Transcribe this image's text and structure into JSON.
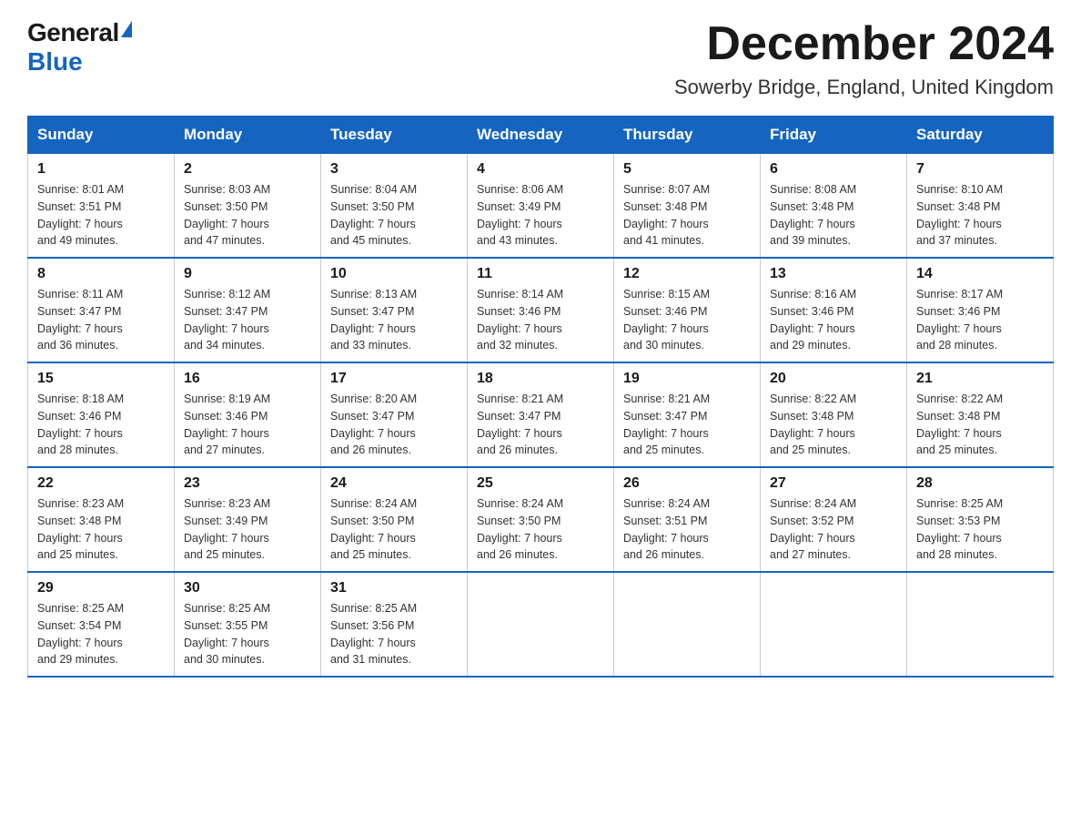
{
  "header": {
    "logo_general": "General",
    "logo_blue": "Blue",
    "title": "December 2024",
    "subtitle": "Sowerby Bridge, England, United Kingdom"
  },
  "weekdays": [
    "Sunday",
    "Monday",
    "Tuesday",
    "Wednesday",
    "Thursday",
    "Friday",
    "Saturday"
  ],
  "weeks": [
    [
      {
        "day": "1",
        "sunrise": "8:01 AM",
        "sunset": "3:51 PM",
        "daylight": "7 hours and 49 minutes."
      },
      {
        "day": "2",
        "sunrise": "8:03 AM",
        "sunset": "3:50 PM",
        "daylight": "7 hours and 47 minutes."
      },
      {
        "day": "3",
        "sunrise": "8:04 AM",
        "sunset": "3:50 PM",
        "daylight": "7 hours and 45 minutes."
      },
      {
        "day": "4",
        "sunrise": "8:06 AM",
        "sunset": "3:49 PM",
        "daylight": "7 hours and 43 minutes."
      },
      {
        "day": "5",
        "sunrise": "8:07 AM",
        "sunset": "3:48 PM",
        "daylight": "7 hours and 41 minutes."
      },
      {
        "day": "6",
        "sunrise": "8:08 AM",
        "sunset": "3:48 PM",
        "daylight": "7 hours and 39 minutes."
      },
      {
        "day": "7",
        "sunrise": "8:10 AM",
        "sunset": "3:48 PM",
        "daylight": "7 hours and 37 minutes."
      }
    ],
    [
      {
        "day": "8",
        "sunrise": "8:11 AM",
        "sunset": "3:47 PM",
        "daylight": "7 hours and 36 minutes."
      },
      {
        "day": "9",
        "sunrise": "8:12 AM",
        "sunset": "3:47 PM",
        "daylight": "7 hours and 34 minutes."
      },
      {
        "day": "10",
        "sunrise": "8:13 AM",
        "sunset": "3:47 PM",
        "daylight": "7 hours and 33 minutes."
      },
      {
        "day": "11",
        "sunrise": "8:14 AM",
        "sunset": "3:46 PM",
        "daylight": "7 hours and 32 minutes."
      },
      {
        "day": "12",
        "sunrise": "8:15 AM",
        "sunset": "3:46 PM",
        "daylight": "7 hours and 30 minutes."
      },
      {
        "day": "13",
        "sunrise": "8:16 AM",
        "sunset": "3:46 PM",
        "daylight": "7 hours and 29 minutes."
      },
      {
        "day": "14",
        "sunrise": "8:17 AM",
        "sunset": "3:46 PM",
        "daylight": "7 hours and 28 minutes."
      }
    ],
    [
      {
        "day": "15",
        "sunrise": "8:18 AM",
        "sunset": "3:46 PM",
        "daylight": "7 hours and 28 minutes."
      },
      {
        "day": "16",
        "sunrise": "8:19 AM",
        "sunset": "3:46 PM",
        "daylight": "7 hours and 27 minutes."
      },
      {
        "day": "17",
        "sunrise": "8:20 AM",
        "sunset": "3:47 PM",
        "daylight": "7 hours and 26 minutes."
      },
      {
        "day": "18",
        "sunrise": "8:21 AM",
        "sunset": "3:47 PM",
        "daylight": "7 hours and 26 minutes."
      },
      {
        "day": "19",
        "sunrise": "8:21 AM",
        "sunset": "3:47 PM",
        "daylight": "7 hours and 25 minutes."
      },
      {
        "day": "20",
        "sunrise": "8:22 AM",
        "sunset": "3:48 PM",
        "daylight": "7 hours and 25 minutes."
      },
      {
        "day": "21",
        "sunrise": "8:22 AM",
        "sunset": "3:48 PM",
        "daylight": "7 hours and 25 minutes."
      }
    ],
    [
      {
        "day": "22",
        "sunrise": "8:23 AM",
        "sunset": "3:48 PM",
        "daylight": "7 hours and 25 minutes."
      },
      {
        "day": "23",
        "sunrise": "8:23 AM",
        "sunset": "3:49 PM",
        "daylight": "7 hours and 25 minutes."
      },
      {
        "day": "24",
        "sunrise": "8:24 AM",
        "sunset": "3:50 PM",
        "daylight": "7 hours and 25 minutes."
      },
      {
        "day": "25",
        "sunrise": "8:24 AM",
        "sunset": "3:50 PM",
        "daylight": "7 hours and 26 minutes."
      },
      {
        "day": "26",
        "sunrise": "8:24 AM",
        "sunset": "3:51 PM",
        "daylight": "7 hours and 26 minutes."
      },
      {
        "day": "27",
        "sunrise": "8:24 AM",
        "sunset": "3:52 PM",
        "daylight": "7 hours and 27 minutes."
      },
      {
        "day": "28",
        "sunrise": "8:25 AM",
        "sunset": "3:53 PM",
        "daylight": "7 hours and 28 minutes."
      }
    ],
    [
      {
        "day": "29",
        "sunrise": "8:25 AM",
        "sunset": "3:54 PM",
        "daylight": "7 hours and 29 minutes."
      },
      {
        "day": "30",
        "sunrise": "8:25 AM",
        "sunset": "3:55 PM",
        "daylight": "7 hours and 30 minutes."
      },
      {
        "day": "31",
        "sunrise": "8:25 AM",
        "sunset": "3:56 PM",
        "daylight": "7 hours and 31 minutes."
      },
      null,
      null,
      null,
      null
    ]
  ],
  "labels": {
    "sunrise": "Sunrise:",
    "sunset": "Sunset:",
    "daylight": "Daylight:"
  }
}
